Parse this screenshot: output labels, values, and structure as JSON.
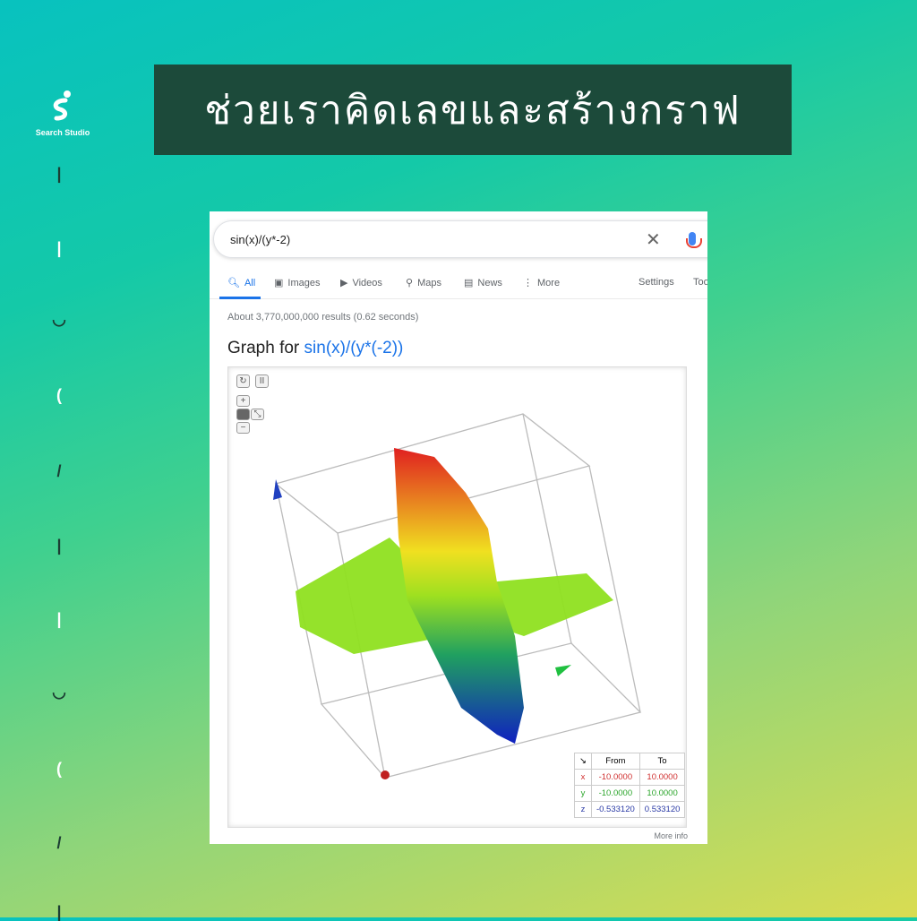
{
  "brand": {
    "name": "Search Studio"
  },
  "banner": {
    "title": "ช่วยเราคิดเลขและสร้างกราฟ"
  },
  "search": {
    "query": "sin(x)/(y*-2)"
  },
  "tabs": [
    {
      "label": "All",
      "icon": "search-icon"
    },
    {
      "label": "Images",
      "icon": "image-icon"
    },
    {
      "label": "Videos",
      "icon": "play-icon"
    },
    {
      "label": "Maps",
      "icon": "pin-icon"
    },
    {
      "label": "News",
      "icon": "news-icon"
    },
    {
      "label": "More",
      "icon": "dots-icon"
    },
    {
      "label": "Settings"
    },
    {
      "label": "Too"
    }
  ],
  "stats": "About 3,770,000,000 results (0.62 seconds)",
  "graph": {
    "title_prefix": "Graph for",
    "formula": "sin(x)/(y*(-2))",
    "controls": {
      "reset": "↻",
      "pause": "II",
      "zoom_in": "+",
      "zoom_out": "−"
    },
    "range": {
      "headers": [
        "From",
        "To"
      ],
      "rows": [
        {
          "axis": "x",
          "from": "-10.0000",
          "to": "10.0000",
          "color": "#d03030"
        },
        {
          "axis": "y",
          "from": "-10.0000",
          "to": "10.0000",
          "color": "#2aa52a"
        },
        {
          "axis": "z",
          "from": "-0.533120",
          "to": "0.533120",
          "color": "#2a3aa5"
        }
      ]
    },
    "more_info": "More info"
  },
  "colors": {
    "accent": "#1a73e8",
    "banner": "#1c4a3a"
  }
}
